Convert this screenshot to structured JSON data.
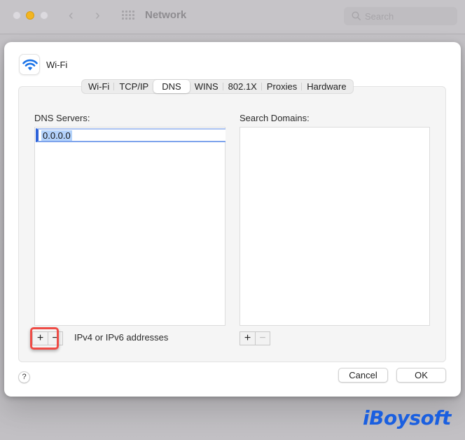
{
  "window": {
    "title": "Network",
    "search_placeholder": "Search",
    "back_icon": "chevron-left-icon",
    "forward_icon": "chevron-right-icon",
    "grid_icon": "grid-icon"
  },
  "sheet": {
    "interface_name": "Wi-Fi",
    "interface_icon": "wifi-icon",
    "accent_color": "#1a73e8",
    "tabs": [
      {
        "label": "Wi-Fi",
        "active": false
      },
      {
        "label": "TCP/IP",
        "active": false
      },
      {
        "label": "DNS",
        "active": true
      },
      {
        "label": "WINS",
        "active": false
      },
      {
        "label": "802.1X",
        "active": false
      },
      {
        "label": "Proxies",
        "active": false
      },
      {
        "label": "Hardware",
        "active": false
      }
    ],
    "dns_servers": {
      "label": "DNS Servers:",
      "entries": [
        "0.0.0.0"
      ],
      "add_label": "+",
      "remove_label": "−",
      "hint": "IPv4 or IPv6 addresses"
    },
    "search_domains": {
      "label": "Search Domains:",
      "entries": [],
      "add_label": "+",
      "remove_label": "−"
    },
    "help_label": "?",
    "cancel_label": "Cancel",
    "ok_label": "OK",
    "highlight_color": "#ef4b45"
  },
  "watermark": "iBoysoft"
}
